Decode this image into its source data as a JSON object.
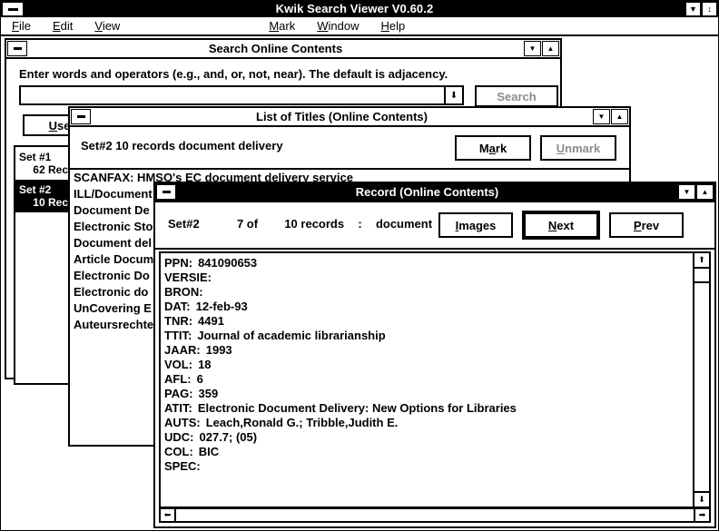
{
  "app": {
    "title": "Kwik Search Viewer V0.60.2",
    "minimize_glyph": "▼",
    "maximize_glyph": "↕",
    "menu": [
      {
        "label": "File",
        "accel": "F"
      },
      {
        "label": "Edit",
        "accel": "E"
      },
      {
        "label": "View",
        "accel": "V"
      },
      {
        "label": "Mark",
        "accel": "M"
      },
      {
        "label": "Window",
        "accel": "W"
      },
      {
        "label": "Help",
        "accel": "H"
      }
    ]
  },
  "search_window": {
    "title": "Search Online Contents",
    "prompt": "Enter words and operators (e.g., and, or, not, near). The default is adjacency.",
    "query_value": "",
    "query_placeholder": "",
    "combo_arrow_glyph": "⬇",
    "search_button": "Search",
    "search_button_enabled": false,
    "use_set_button": "Use s",
    "sets": [
      {
        "name": "Set #1",
        "records": "62 Rec",
        "selected": false
      },
      {
        "name": "Set #2",
        "records": "10 Rec",
        "selected": true
      }
    ],
    "minimize_glyph": "▼",
    "maximize_glyph": "▲"
  },
  "titles_window": {
    "title": "List of Titles (Online Contents)",
    "summary": "Set#2   10 records   document delivery",
    "mark_button": "Mark",
    "mark_accel": "a",
    "unmark_button": "Unmark",
    "unmark_accel": "U",
    "unmark_enabled": false,
    "minimize_glyph": "▼",
    "maximize_glyph": "▲",
    "titles": [
      "SCANFAX: HMSO's EC document delivery service",
      "ILL/Document",
      "Document De",
      "Electronic Sto",
      "Document del",
      "Article Docum",
      "Electronic Do",
      "Electronic do",
      "UnCovering E",
      "Auteursrechte"
    ]
  },
  "record_window": {
    "title": "Record (Online Contents)",
    "set_label": "Set#2",
    "position": "7 of",
    "total": "10 records",
    "separator": ":",
    "kind": "document",
    "images_button": "Images",
    "images_accel": "I",
    "next_button": "Next",
    "next_accel": "N",
    "prev_button": "Prev",
    "prev_accel": "P",
    "minimize_glyph": "▼",
    "maximize_glyph": "▲",
    "scroll_up_glyph": "⬆",
    "scroll_down_glyph": "⬇",
    "scroll_left_glyph": "⬅",
    "scroll_right_glyph": "➡",
    "fields": [
      {
        "label": "PPN:",
        "value": "841090653"
      },
      {
        "label": "VERSIE:",
        "value": ""
      },
      {
        "label": "BRON:",
        "value": ""
      },
      {
        "label": "DAT:",
        "value": "12-feb-93"
      },
      {
        "label": "TNR:",
        "value": "4491"
      },
      {
        "label": "TTIT:",
        "value": "Journal of academic librarianship"
      },
      {
        "label": "JAAR:",
        "value": "1993"
      },
      {
        "label": "VOL:",
        "value": "18"
      },
      {
        "label": "AFL:",
        "value": "6"
      },
      {
        "label": "PAG:",
        "value": "359"
      },
      {
        "label": "ATIT:",
        "value": "Electronic Document Delivery: New Options for Libraries"
      },
      {
        "label": "AUTS:",
        "value": "Leach,Ronald G.; Tribble,Judith E."
      },
      {
        "label": "UDC:",
        "value": "027.7; (05)"
      },
      {
        "label": "COL:",
        "value": "BIC"
      },
      {
        "label": "SPEC:",
        "value": ""
      }
    ]
  },
  "colors": {
    "window_bg": "#ffffff",
    "border": "#000000",
    "active_titlebar": "#000000",
    "active_title_text": "#ffffff",
    "disabled_text": "#8c8c8c",
    "selection_bg": "#000000",
    "selection_text": "#ffffff"
  }
}
